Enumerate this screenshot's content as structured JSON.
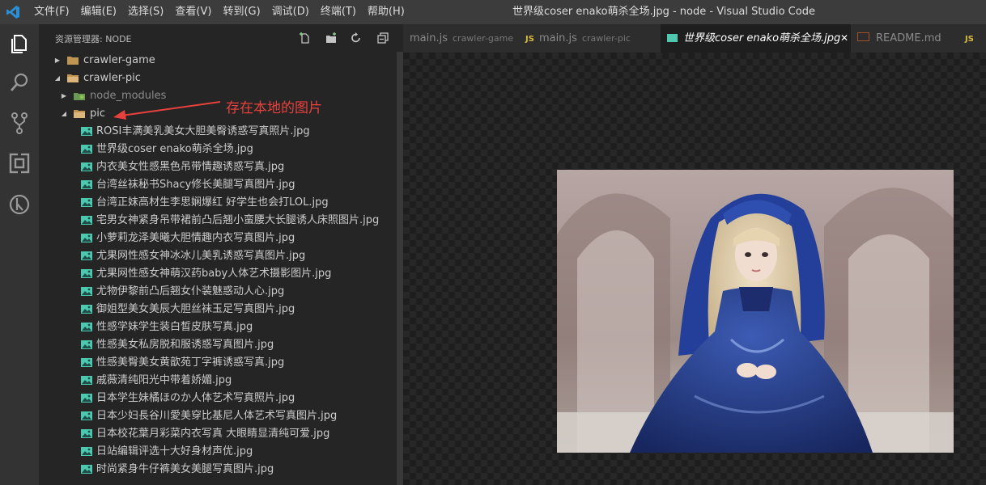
{
  "menu": [
    "文件(F)",
    "编辑(E)",
    "选择(S)",
    "查看(V)",
    "转到(G)",
    "调试(D)",
    "终端(T)",
    "帮助(H)"
  ],
  "window_title": "世界级coser enako萌杀全场.jpg - node - Visual Studio Code",
  "sidebar": {
    "title": "资源管理器: NODE",
    "tree": [
      {
        "label": "crawler-game",
        "kind": "folder",
        "indent": 0,
        "twisty": "▶"
      },
      {
        "label": "crawler-pic",
        "kind": "folder-open",
        "indent": 0,
        "twisty": "◢"
      },
      {
        "label": "node_modules",
        "kind": "node",
        "indent": 1,
        "twisty": "▶"
      },
      {
        "label": "pic",
        "kind": "folder-open",
        "indent": 1,
        "twisty": "◢"
      },
      {
        "label": "ROSI丰满美乳美女大胆美臀诱惑写真照片.jpg",
        "kind": "image",
        "indent": 2
      },
      {
        "label": "世界级coser enako萌杀全场.jpg",
        "kind": "image",
        "indent": 2
      },
      {
        "label": "内衣美女性感黑色吊带情趣诱惑写真.jpg",
        "kind": "image",
        "indent": 2
      },
      {
        "label": "台湾丝袜秘书Shacy修长美腿写真图片.jpg",
        "kind": "image",
        "indent": 2
      },
      {
        "label": "台湾正妹高材生李思娴爆红 好学生也会打LOL.jpg",
        "kind": "image",
        "indent": 2
      },
      {
        "label": "宅男女神紧身吊带裙前凸后翘小蛮腰大长腿诱人床照图片.jpg",
        "kind": "image",
        "indent": 2
      },
      {
        "label": "小萝莉龙泽美曦大胆情趣内衣写真图片.jpg",
        "kind": "image",
        "indent": 2
      },
      {
        "label": "尤果网性感女神冰冰儿美乳诱惑写真图片.jpg",
        "kind": "image",
        "indent": 2
      },
      {
        "label": "尤果网性感女神萌汉药baby人体艺术摄影图片.jpg",
        "kind": "image",
        "indent": 2
      },
      {
        "label": "尤物伊黎前凸后翘女仆装魅惑动人心.jpg",
        "kind": "image",
        "indent": 2
      },
      {
        "label": "御姐型美女美辰大胆丝袜玉足写真图片.jpg",
        "kind": "image",
        "indent": 2
      },
      {
        "label": "性感学妹学生装白皙皮肤写真.jpg",
        "kind": "image",
        "indent": 2
      },
      {
        "label": "性感美女私房脱和服诱惑写真图片.jpg",
        "kind": "image",
        "indent": 2
      },
      {
        "label": "性感美臀美女黄歆苑丁字裤诱惑写真.jpg",
        "kind": "image",
        "indent": 2
      },
      {
        "label": "戚薇清纯阳光中带着娇媚.jpg",
        "kind": "image",
        "indent": 2
      },
      {
        "label": "日本学生妹橘ほのか人体艺术写真照片.jpg",
        "kind": "image",
        "indent": 2
      },
      {
        "label": "日本少妇長谷川愛美穿比基尼人体艺术写真图片.jpg",
        "kind": "image",
        "indent": 2
      },
      {
        "label": "日本校花葉月彩菜内衣写真 大眼睛显清纯可爱.jpg",
        "kind": "image",
        "indent": 2
      },
      {
        "label": "日站编辑评选十大好身材声优.jpg",
        "kind": "image",
        "indent": 2
      },
      {
        "label": "时尚紧身牛仔裤美女美腿写真图片.jpg",
        "kind": "image",
        "indent": 2
      }
    ]
  },
  "tabs": [
    {
      "label": "main.js",
      "desc": "crawler-game",
      "kind": "none",
      "active": false
    },
    {
      "label": "main.js",
      "desc": "crawler-pic",
      "kind": "js",
      "active": false
    },
    {
      "label": "世界级coser enako萌杀全场.jpg",
      "desc": "",
      "kind": "image",
      "active": true
    },
    {
      "label": "README.md",
      "desc": "",
      "kind": "md",
      "active": false
    },
    {
      "label": "",
      "desc": "",
      "kind": "js",
      "active": false
    }
  ],
  "tab_icons": {
    "js": "JS"
  },
  "annotation": "存在本地的图片",
  "colors": {
    "accent": "#007acc",
    "annotation": "#e8413d",
    "image_icon": "#4ec9b0",
    "folder": "#c09553"
  }
}
